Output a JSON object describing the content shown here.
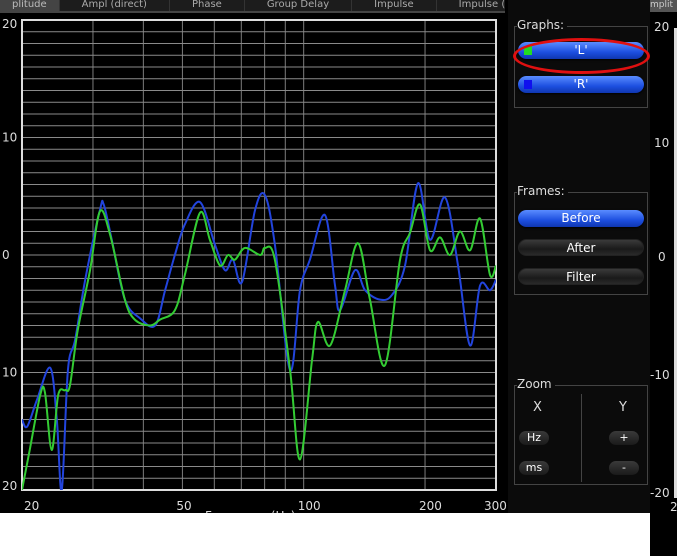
{
  "tabs": [
    {
      "label": "plitude",
      "active": true
    },
    {
      "label": "Ampl (direct)"
    },
    {
      "label": "Phase"
    },
    {
      "label": "Group Delay"
    },
    {
      "label": "Impulse"
    },
    {
      "label": "Impulse (ln)"
    }
  ],
  "panel": {
    "graphs_label": "Graphs:",
    "graphs": [
      {
        "label": "'L'",
        "color": "#22dd22"
      },
      {
        "label": "'R'",
        "color": "#1010ee"
      }
    ],
    "frames_label": "Frames:",
    "frames": [
      {
        "label": "Before",
        "active": true
      },
      {
        "label": "After"
      },
      {
        "label": "Filter"
      }
    ],
    "zoom_label": "Zoom",
    "zoom_x": "X",
    "zoom_y": "Y",
    "hz": "Hz",
    "ms": "ms",
    "plus": "+",
    "minus": "-"
  },
  "side": {
    "tab": "mplit",
    "labels": [
      "20",
      "10",
      "0",
      "-10",
      "-20"
    ],
    "xlabel": "2"
  },
  "chart_data": {
    "type": "line",
    "xscale": "log",
    "xlim": [
      20,
      300
    ],
    "ylim": [
      -20,
      20
    ],
    "xticks": [
      20,
      50,
      100,
      200,
      300
    ],
    "xgrid": [
      30,
      40,
      50,
      60,
      70,
      80,
      90,
      100,
      200
    ],
    "yticks": [
      20,
      10,
      0,
      -10,
      -20
    ],
    "ytick_labels": [
      "20",
      "10",
      "0",
      "10",
      "20"
    ],
    "xtick_labels": [
      "20",
      "50",
      "100",
      "200",
      "300"
    ],
    "xlabel": "Frequency (Hz)",
    "series": [
      {
        "name": "'R'",
        "color": "#2244dd",
        "points": [
          [
            20,
            -14
          ],
          [
            20.6,
            -14.6
          ],
          [
            21.8,
            -12.3
          ],
          [
            23.5,
            -9.6
          ],
          [
            24.4,
            -14
          ],
          [
            25.1,
            -20
          ],
          [
            26,
            -9.8
          ],
          [
            27.1,
            -7.2
          ],
          [
            28.7,
            -2.1
          ],
          [
            31.2,
            3.8
          ],
          [
            31.9,
            4.3
          ],
          [
            33.4,
            1.3
          ],
          [
            36,
            -3.8
          ],
          [
            39.3,
            -5.4
          ],
          [
            42.8,
            -6
          ],
          [
            45.3,
            -3
          ],
          [
            47.9,
            0
          ],
          [
            50.7,
            2.6
          ],
          [
            55.3,
            4.5
          ],
          [
            60.2,
            0.9
          ],
          [
            63.8,
            -1.3
          ],
          [
            66.7,
            -0.4
          ],
          [
            70.3,
            -2.3
          ],
          [
            75.7,
            3.8
          ],
          [
            80.1,
            5.1
          ],
          [
            84.8,
            0.9
          ],
          [
            92.5,
            -9.8
          ],
          [
            97.9,
            -3
          ],
          [
            103.6,
            -0.4
          ],
          [
            112.9,
            3.4
          ],
          [
            119.6,
            -2.6
          ],
          [
            123.1,
            -4.7
          ],
          [
            134,
            -1.3
          ],
          [
            142,
            -3
          ],
          [
            154.6,
            -3.8
          ],
          [
            165.6,
            -3.4
          ],
          [
            178.4,
            -0.9
          ],
          [
            192.1,
            6.1
          ],
          [
            205.8,
            1.3
          ],
          [
            224.2,
            4.9
          ],
          [
            241.5,
            -0.9
          ],
          [
            258.7,
            -7.7
          ],
          [
            273.9,
            -2.6
          ],
          [
            289.9,
            -3
          ],
          [
            300,
            -2.1
          ]
        ]
      },
      {
        "name": "'L'",
        "color": "#33cc33",
        "points": [
          [
            20,
            -20
          ],
          [
            20.9,
            -16.6
          ],
          [
            22.2,
            -11.9
          ],
          [
            22.8,
            -11.7
          ],
          [
            23.7,
            -16.6
          ],
          [
            24.6,
            -11.9
          ],
          [
            25.6,
            -11.5
          ],
          [
            26.3,
            -11.1
          ],
          [
            27.5,
            -6.4
          ],
          [
            29.5,
            -1.3
          ],
          [
            31.2,
            3.7
          ],
          [
            33.1,
            1.7
          ],
          [
            36,
            -3.8
          ],
          [
            38.1,
            -5.5
          ],
          [
            41.6,
            -6
          ],
          [
            44,
            -5.5
          ],
          [
            47.9,
            -4.7
          ],
          [
            50.7,
            -1.7
          ],
          [
            55.3,
            3.6
          ],
          [
            58.5,
            1.3
          ],
          [
            62,
            -0.9
          ],
          [
            64.9,
            0
          ],
          [
            67.5,
            -0.4
          ],
          [
            71.5,
            0.6
          ],
          [
            78,
            0
          ],
          [
            80.1,
            0.6
          ],
          [
            84.8,
            -0.4
          ],
          [
            92.5,
            -9.8
          ],
          [
            97.9,
            -17.4
          ],
          [
            104.9,
            -8.9
          ],
          [
            108.5,
            -5.7
          ],
          [
            116.3,
            -7.7
          ],
          [
            126.6,
            -3
          ],
          [
            136.4,
            1
          ],
          [
            146,
            -3.8
          ],
          [
            159,
            -9.4
          ],
          [
            173.4,
            -0.4
          ],
          [
            183.6,
            1.9
          ],
          [
            194.4,
            4.3
          ],
          [
            205.8,
            0.4
          ],
          [
            217.9,
            1.5
          ],
          [
            230.6,
            0
          ],
          [
            244.2,
            2
          ],
          [
            258.7,
            0.4
          ],
          [
            273.9,
            3.1
          ],
          [
            289.9,
            -1.7
          ],
          [
            300,
            -0.9
          ]
        ]
      }
    ]
  }
}
